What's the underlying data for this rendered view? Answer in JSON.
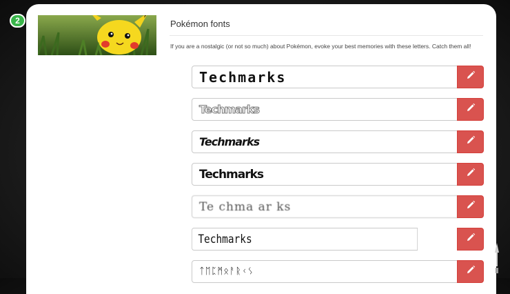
{
  "step_badge": "2",
  "section": {
    "title": "Pokémon fonts",
    "description": "If you are a nostalgic (or not so much) about Pokémon, evoke your best memories with these letters. Catch them all!"
  },
  "font_rows": [
    {
      "preview": "Techmarks",
      "edit_icon": "pencil-icon"
    },
    {
      "preview": "Techmarks",
      "edit_icon": "pencil-icon"
    },
    {
      "preview": "Techmarks",
      "edit_icon": "pencil-icon"
    },
    {
      "preview": "Techmarks",
      "edit_icon": "pencil-icon"
    },
    {
      "preview": "Te chma ar ks",
      "edit_icon": "pencil-icon"
    },
    {
      "preview": "Techmarks",
      "edit_icon": "pencil-icon"
    },
    {
      "preview": "ᛏᛖᛈᛗᛟᚨᚱᚲᛊ",
      "edit_icon": "pencil-icon"
    }
  ],
  "colors": {
    "badge": "#39b54a",
    "edit_button": "#d9534f",
    "card": "#ffffff"
  }
}
